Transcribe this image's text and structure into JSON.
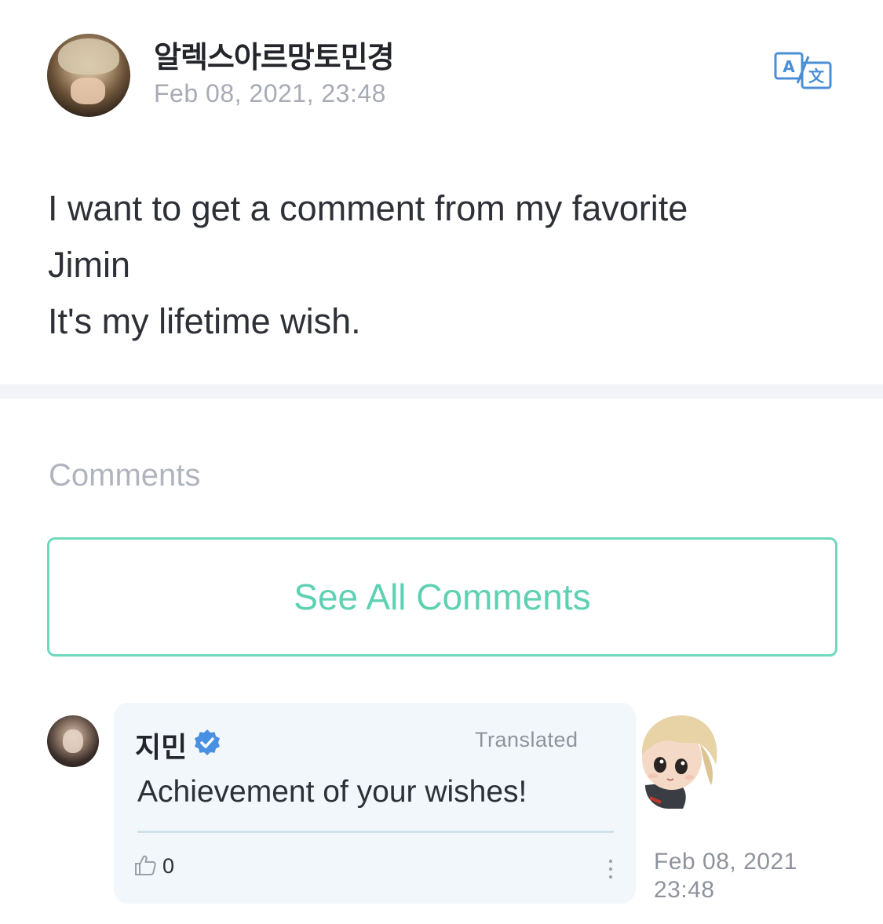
{
  "post": {
    "author": "알렉스아르망토민경",
    "date": "Feb 08, 2021, 23:48",
    "body": "I want to get a comment from my favorite\nJimin\nIt's my lifetime wish.",
    "translate_icon": "translate-icon"
  },
  "comments_section": {
    "heading": "Comments",
    "see_all_label": "See All Comments"
  },
  "comment": {
    "author": "지민",
    "verified_icon": "verified-check-icon",
    "translated_label": "Translated",
    "text": "Achievement of your wishes!",
    "like_count": "0",
    "like_icon": "thumbs-up-icon",
    "more_icon": "more-vertical-icon",
    "date_line1": "Feb 08, 2021",
    "date_line2": "23:48"
  },
  "colors": {
    "accent": "#5fd1b3",
    "border_accent": "#6fd8bd",
    "verified_blue": "#4a90e2",
    "translate_blue": "#4a8fd6",
    "bubble_bg": "#f2f7fc",
    "muted_text": "#a7abb4"
  }
}
